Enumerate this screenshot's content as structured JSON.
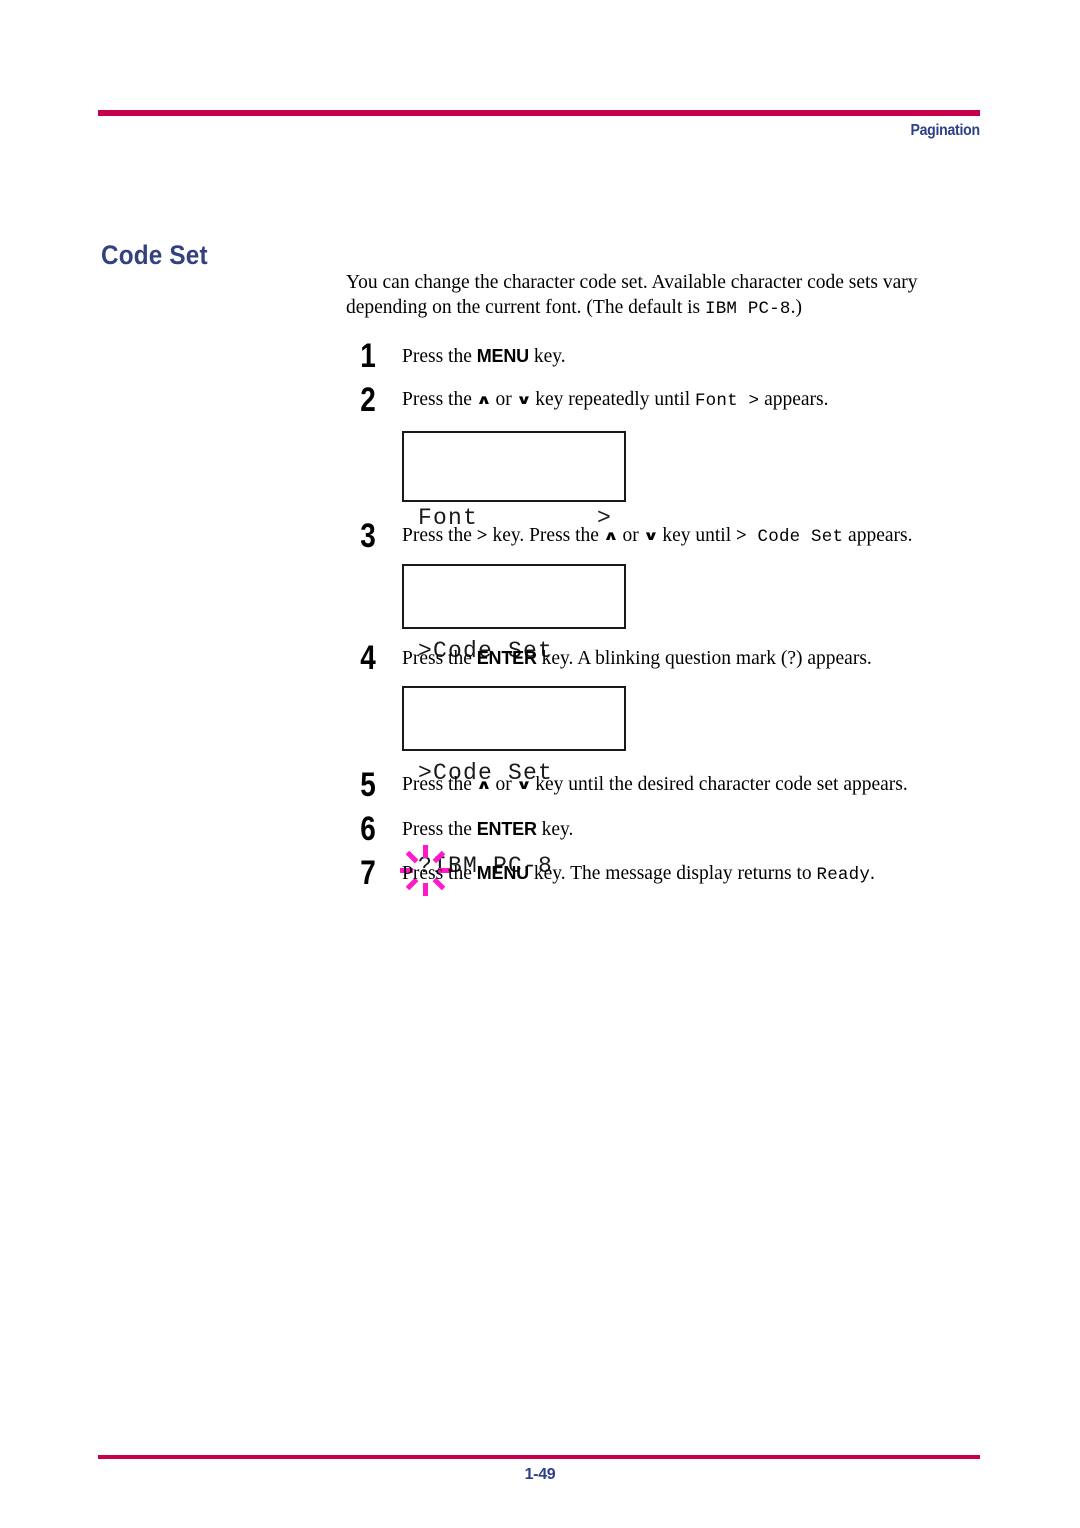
{
  "header": {
    "label": "Pagination",
    "rule_color": "#c8004b",
    "label_color": "#2d3f86"
  },
  "section": {
    "heading": "Code Set",
    "heading_color": "#33427e"
  },
  "intro": {
    "part1": "You can change the character code set. Available character code sets vary depending on the current font. (The default is ",
    "mono": "IBM PC-8",
    "part2": ".)"
  },
  "steps": [
    {
      "number": "1",
      "pre": "Press the ",
      "kbd": "MENU",
      "post": " key."
    },
    {
      "number": "2",
      "pre": "Press the ",
      "up": "∧",
      "mid": " or ",
      "down": "∨",
      "post": " key repeatedly until ",
      "mono": "Font  >",
      "tail": " appears."
    },
    {
      "number": "3",
      "pre": "Press the ",
      "gt": ">",
      "mid1": " key. Press the ",
      "up": "∧",
      "mid2": " or ",
      "down": "∨",
      "mid3": " key until ",
      "gt2": ">",
      "mono": " Code Set",
      "tail": " appears."
    },
    {
      "number": "4",
      "pre": "Press the ",
      "kbd": "ENTER",
      "post": " key. A blinking question mark (?) appears."
    },
    {
      "number": "5",
      "pre": "Press the ",
      "up": "∧",
      "mid": " or ",
      "down": "∨",
      "post": " key until the desired character code set appears."
    },
    {
      "number": "6",
      "pre": "Press the ",
      "kbd": "ENTER",
      "post": " key."
    },
    {
      "number": "7",
      "pre": "Press the ",
      "kbd": "MENU",
      "post": " key. The message display returns to ",
      "mono": "Ready",
      "tail": "."
    }
  ],
  "displays": {
    "font": {
      "line1_left": "Font",
      "line1_right": ">",
      "line2": ""
    },
    "code_set": {
      "line1": ">Code Set",
      "line2": " IBM PC-8"
    },
    "code_set_blink": {
      "line1": ">Code Set",
      "line2_marker": "?",
      "line2_value": "IBM PC-8",
      "blink_color": "#ff19c8"
    }
  },
  "footer": {
    "page_number": "1-49",
    "rule_color": "#c8004b",
    "text_color": "#2d3f86"
  }
}
